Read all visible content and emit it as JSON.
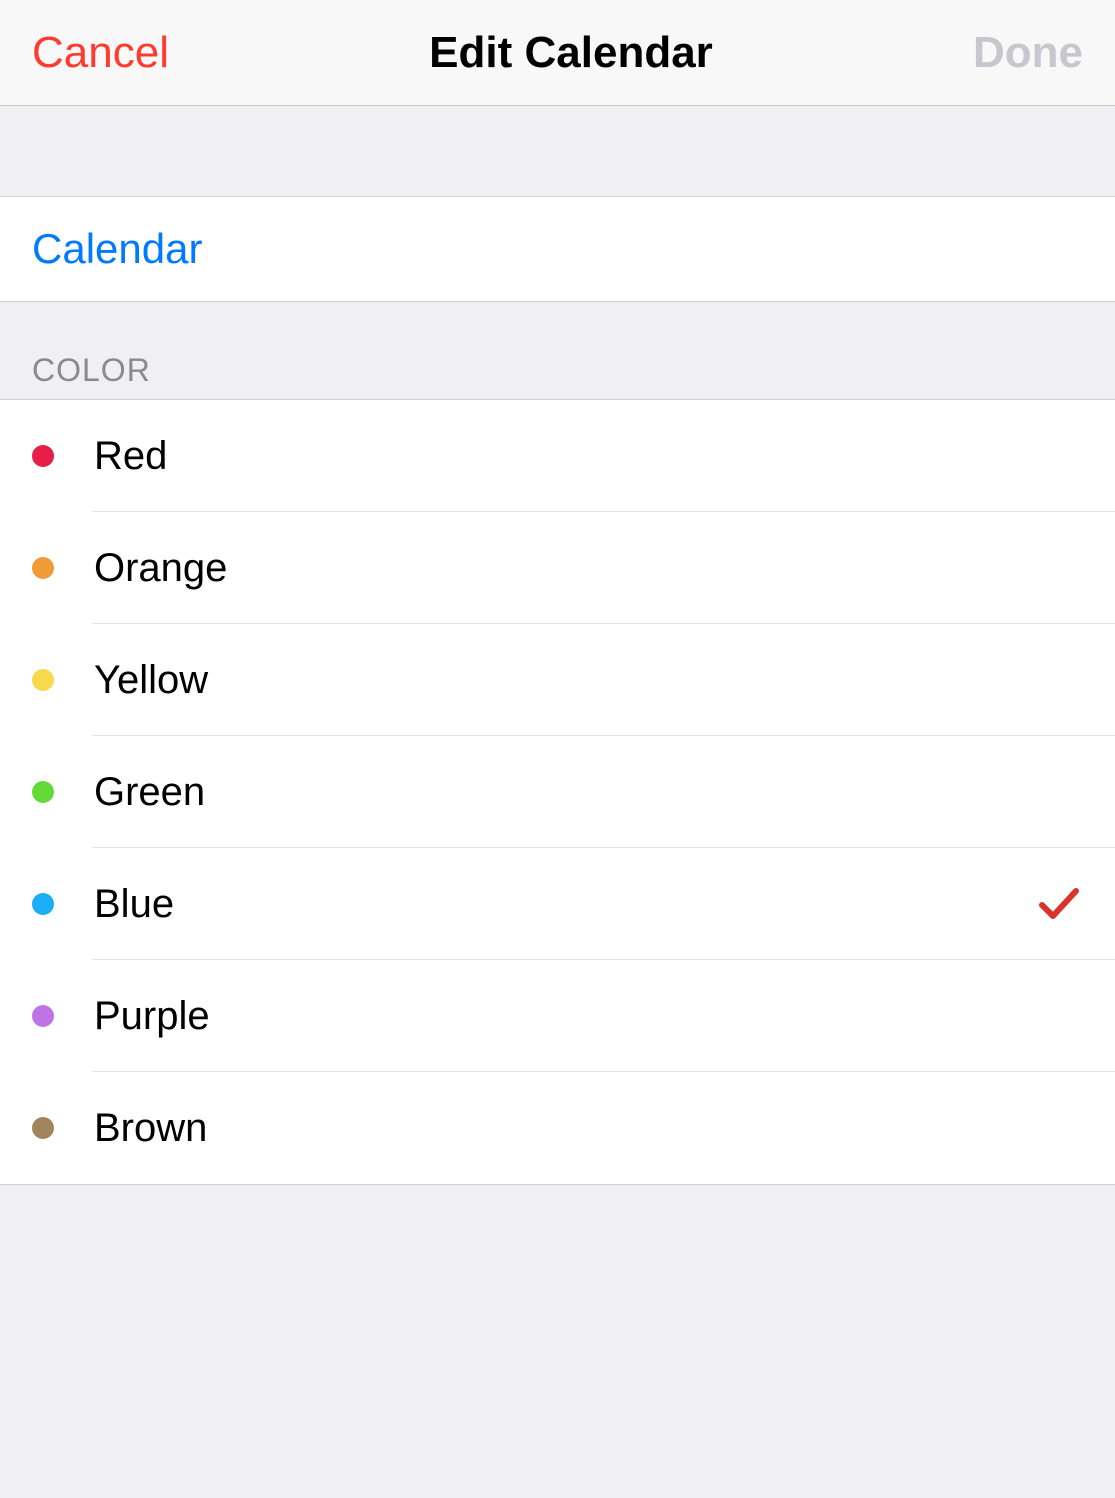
{
  "nav": {
    "cancel_label": "Cancel",
    "title": "Edit Calendar",
    "done_label": "Done"
  },
  "calendar": {
    "name": "Calendar"
  },
  "section_color_header": "COLOR",
  "colors": {
    "selected": "Blue",
    "options": [
      {
        "label": "Red",
        "hex": "#e81e4a"
      },
      {
        "label": "Orange",
        "hex": "#f19a38"
      },
      {
        "label": "Yellow",
        "hex": "#f8d94b"
      },
      {
        "label": "Green",
        "hex": "#63da38"
      },
      {
        "label": "Blue",
        "hex": "#1badf8"
      },
      {
        "label": "Purple",
        "hex": "#c073e4"
      },
      {
        "label": "Brown",
        "hex": "#a2845e"
      }
    ]
  },
  "check_color": "#d9332b"
}
